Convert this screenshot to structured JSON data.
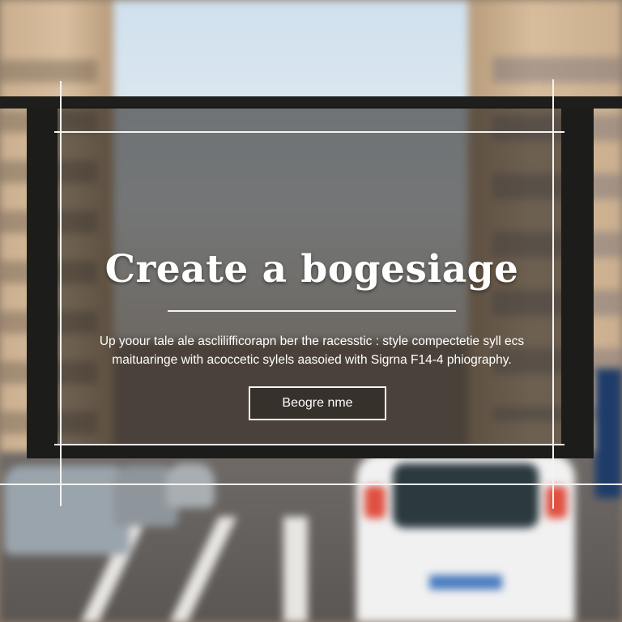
{
  "hero": {
    "title": "Create a bogesiage",
    "subtitle_line1": "Up yoour tale ale asclilifficorapn ber the racesstic : style compectetie syll ecs",
    "subtitle_line2": "maituaringe with acoccetic sylels aasoied with Sigrna F14-4 phiography.",
    "cta_label": "Beogre nme"
  },
  "colors": {
    "frame": "#1c1d1a",
    "lines": "#f4f4f2",
    "text": "#ffffff"
  }
}
